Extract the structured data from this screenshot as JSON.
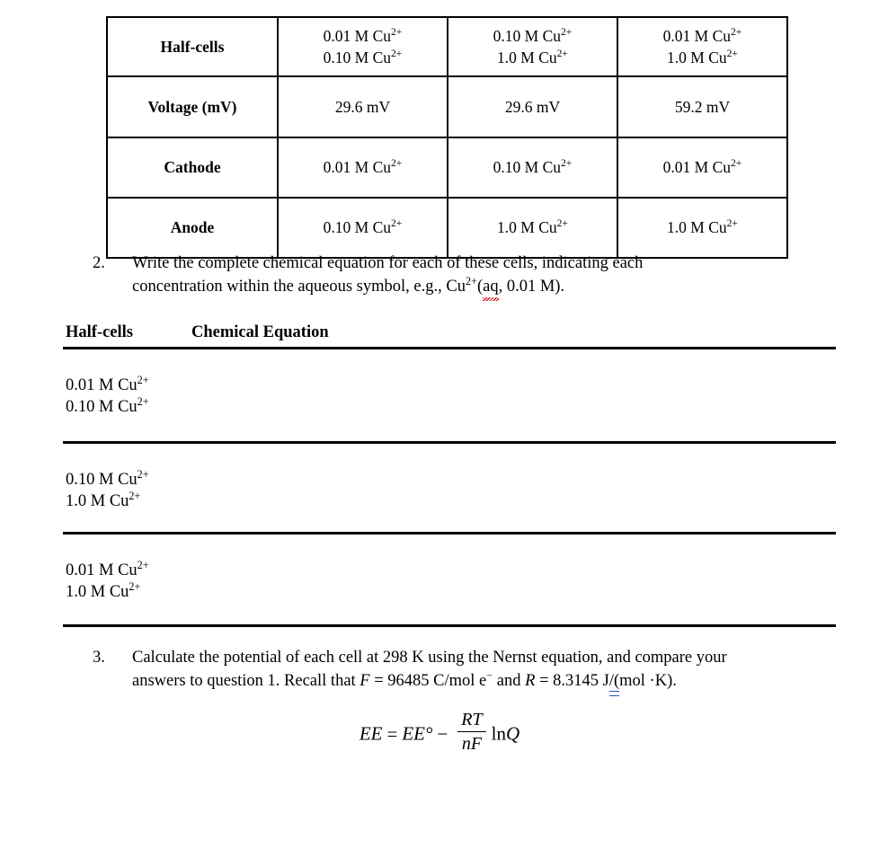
{
  "halfcell_table": {
    "columns": [
      "",
      "col1",
      "col2",
      "col3"
    ],
    "rows": [
      {
        "label": "Half-cells",
        "cells": [
          [
            "0.01 M Cu2+",
            "0.10 M Cu2+"
          ],
          [
            "0.10 M Cu2+",
            "1.0 M Cu2+"
          ],
          [
            "0.01 M Cu2+",
            "1.0 M Cu2+"
          ]
        ]
      },
      {
        "label": "Voltage (mV)",
        "cells": [
          [
            "29.6 mV"
          ],
          [
            "29.6 mV"
          ],
          [
            "59.2 mV"
          ]
        ]
      },
      {
        "label": "Cathode",
        "cells": [
          [
            "0.01 M Cu2+"
          ],
          [
            "0.10 M Cu2+"
          ],
          [
            "0.01 M Cu2+"
          ]
        ]
      },
      {
        "label": "Anode",
        "cells": [
          [
            "0.10 M Cu2+"
          ],
          [
            "1.0 M Cu2+"
          ],
          [
            "1.0 M Cu2+"
          ]
        ]
      }
    ],
    "text": {
      "row_label_halfcells": "Half-cells",
      "row_label_voltage": "Voltage (mV)",
      "row_label_cathode": "Cathode",
      "row_label_anode": "Anode",
      "v_29_6": "29.6 mV",
      "v_59_2": "59.2 mV",
      "c_0_01": "0.01 M Cu",
      "c_0_10": "0.10 M Cu",
      "c_1_0": "1.0 M Cu",
      "charge": "2+"
    }
  },
  "question2": {
    "number": "2.",
    "line1": "Write the complete chemical equation for each of these cells, indicating each",
    "line2_part1": "concentration within the aqueous symbol, e.g., Cu",
    "line2_charge": "2+",
    "line2_part2": "(",
    "line2_spellerror": "aq",
    "line2_part3": ", 0.01 M)."
  },
  "equation_table": {
    "header": {
      "halfcells": "Half-cells",
      "chemical_equation": "Chemical Equation"
    },
    "rows": [
      {
        "halfcell_line1": "0.01 M Cu",
        "halfcell_line2": "0.10 M Cu",
        "answer": ""
      },
      {
        "halfcell_line1": "0.10 M Cu",
        "halfcell_line2": "1.0 M Cu",
        "answer": ""
      },
      {
        "halfcell_line1": "0.01 M Cu",
        "halfcell_line2": "1.0 M Cu",
        "answer": ""
      }
    ],
    "charge": "2+"
  },
  "question3": {
    "number": "3.",
    "line1": "Calculate the potential of each cell at 298 K using the Nernst equation, and compare your",
    "line2_part1": "answers to question 1. Recall that ",
    "line2_F": "F",
    "line2_part2": " = 96485 C/mol e",
    "line2_emarker": "−",
    "line2_part3": " and ",
    "line2_R": "R",
    "line2_part4": " = 8.3145 J",
    "line2_grammar": "/(",
    "line2_part5": "mol ·K)."
  },
  "nernst_formula": {
    "lhs": "EE",
    "equals": "=",
    "e_standard": "EE°",
    "minus": "−",
    "numerator": "RT",
    "denominator": "nF",
    "ln_term": "ln",
    "q_term": "Q"
  }
}
